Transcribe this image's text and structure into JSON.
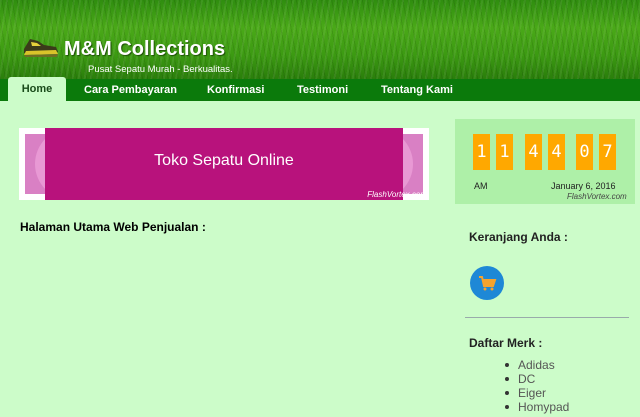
{
  "header": {
    "title": "M&M Collections",
    "tagline": "Pusat Sepatu Murah - Berkualitas."
  },
  "nav": {
    "items": [
      {
        "label": "Home",
        "active": true
      },
      {
        "label": "Cara Pembayaran"
      },
      {
        "label": "Konfirmasi"
      },
      {
        "label": "Testimoni"
      },
      {
        "label": "Tentang Kami"
      }
    ]
  },
  "banner": {
    "text": "Toko Sepatu Online",
    "credit": "FlashVortex.com"
  },
  "main": {
    "heading": "Halaman Utama Web Penjualan :"
  },
  "clock": {
    "digits": [
      "1",
      "1",
      "4",
      "4",
      "0",
      "7"
    ],
    "ampm": "AM",
    "date": "January 6, 2016",
    "credit": "FlashVortex.com"
  },
  "sidebar": {
    "cart_heading": "Keranjang Anda :",
    "brands_heading": "Daftar Merk :",
    "brands": [
      "Adidas",
      "DC",
      "Eiger",
      "Homypad"
    ]
  },
  "colors": {
    "nav_bg": "#0b7a0b",
    "page_bg": "#ccfcc9",
    "banner_magenta": "#b8127c",
    "clock_orange": "#ffa800",
    "cart_blue": "#1e88d6"
  }
}
